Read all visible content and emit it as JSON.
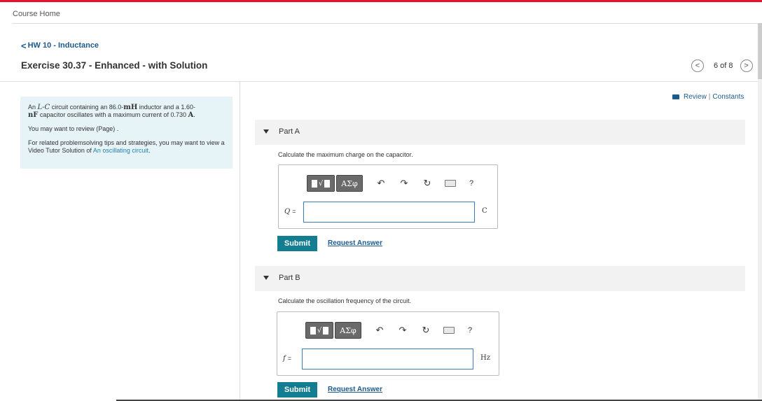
{
  "nav": {
    "course_home": "Course Home",
    "back_label": "HW 10 - Inductance",
    "back_chevron": "<"
  },
  "exercise": {
    "title": "Exercise 30.37 - Enhanced - with Solution"
  },
  "pager": {
    "count": "6 of 8",
    "prev_glyph": "<",
    "next_glyph": ">"
  },
  "links": {
    "review": "Review",
    "separator": "|",
    "constants": "Constants"
  },
  "problem": {
    "line1_a": "An ",
    "line1_math": "L-C",
    "line1_b": " circuit containing an 86.0-",
    "line1_unit": "mH",
    "line1_c": " inductor and a 1.60-",
    "line2_unit": "nF",
    "line2_a": " capacitor oscillates with a maximum current of 0.730 ",
    "line2_unit2": "A",
    "line2_b": ".",
    "review_text": "You may want to review (Page) .",
    "tips_text": "For related problemsolving tips and strategies, you may want to view a Video Tutor Solution of ",
    "tips_link": "An oscillating circuit",
    "tips_end": "."
  },
  "parts": [
    {
      "title": "Part A",
      "question": "Calculate the maximum charge on the capacitor.",
      "variable": "Q",
      "equals": "=",
      "value": "",
      "unit": "C",
      "submit": "Submit",
      "request": "Request Answer"
    },
    {
      "title": "Part B",
      "question": "Calculate the oscillation frequency of the circuit.",
      "variable": "f",
      "equals": "=",
      "value": "",
      "unit": "Hz",
      "submit": "Submit",
      "request": "Request Answer"
    }
  ],
  "toolbar": {
    "templates_root": "√",
    "greek": "ΑΣφ",
    "undo": "↶",
    "redo": "↷",
    "reset": "↻",
    "help": "?"
  },
  "icons": {
    "back": "chevron-left-icon",
    "prev": "chevron-left-icon",
    "next": "chevron-right-icon",
    "review": "book-icon",
    "collapse": "triangle-down-icon",
    "undo": "undo-icon",
    "redo": "redo-icon",
    "reset": "reset-icon",
    "keyboard": "keyboard-icon",
    "help": "help-icon"
  },
  "colors": {
    "brand_red": "#e8112d",
    "link_blue": "#1c5a8c",
    "submit_teal": "#137d91",
    "info_bg": "#e6f4f8"
  }
}
